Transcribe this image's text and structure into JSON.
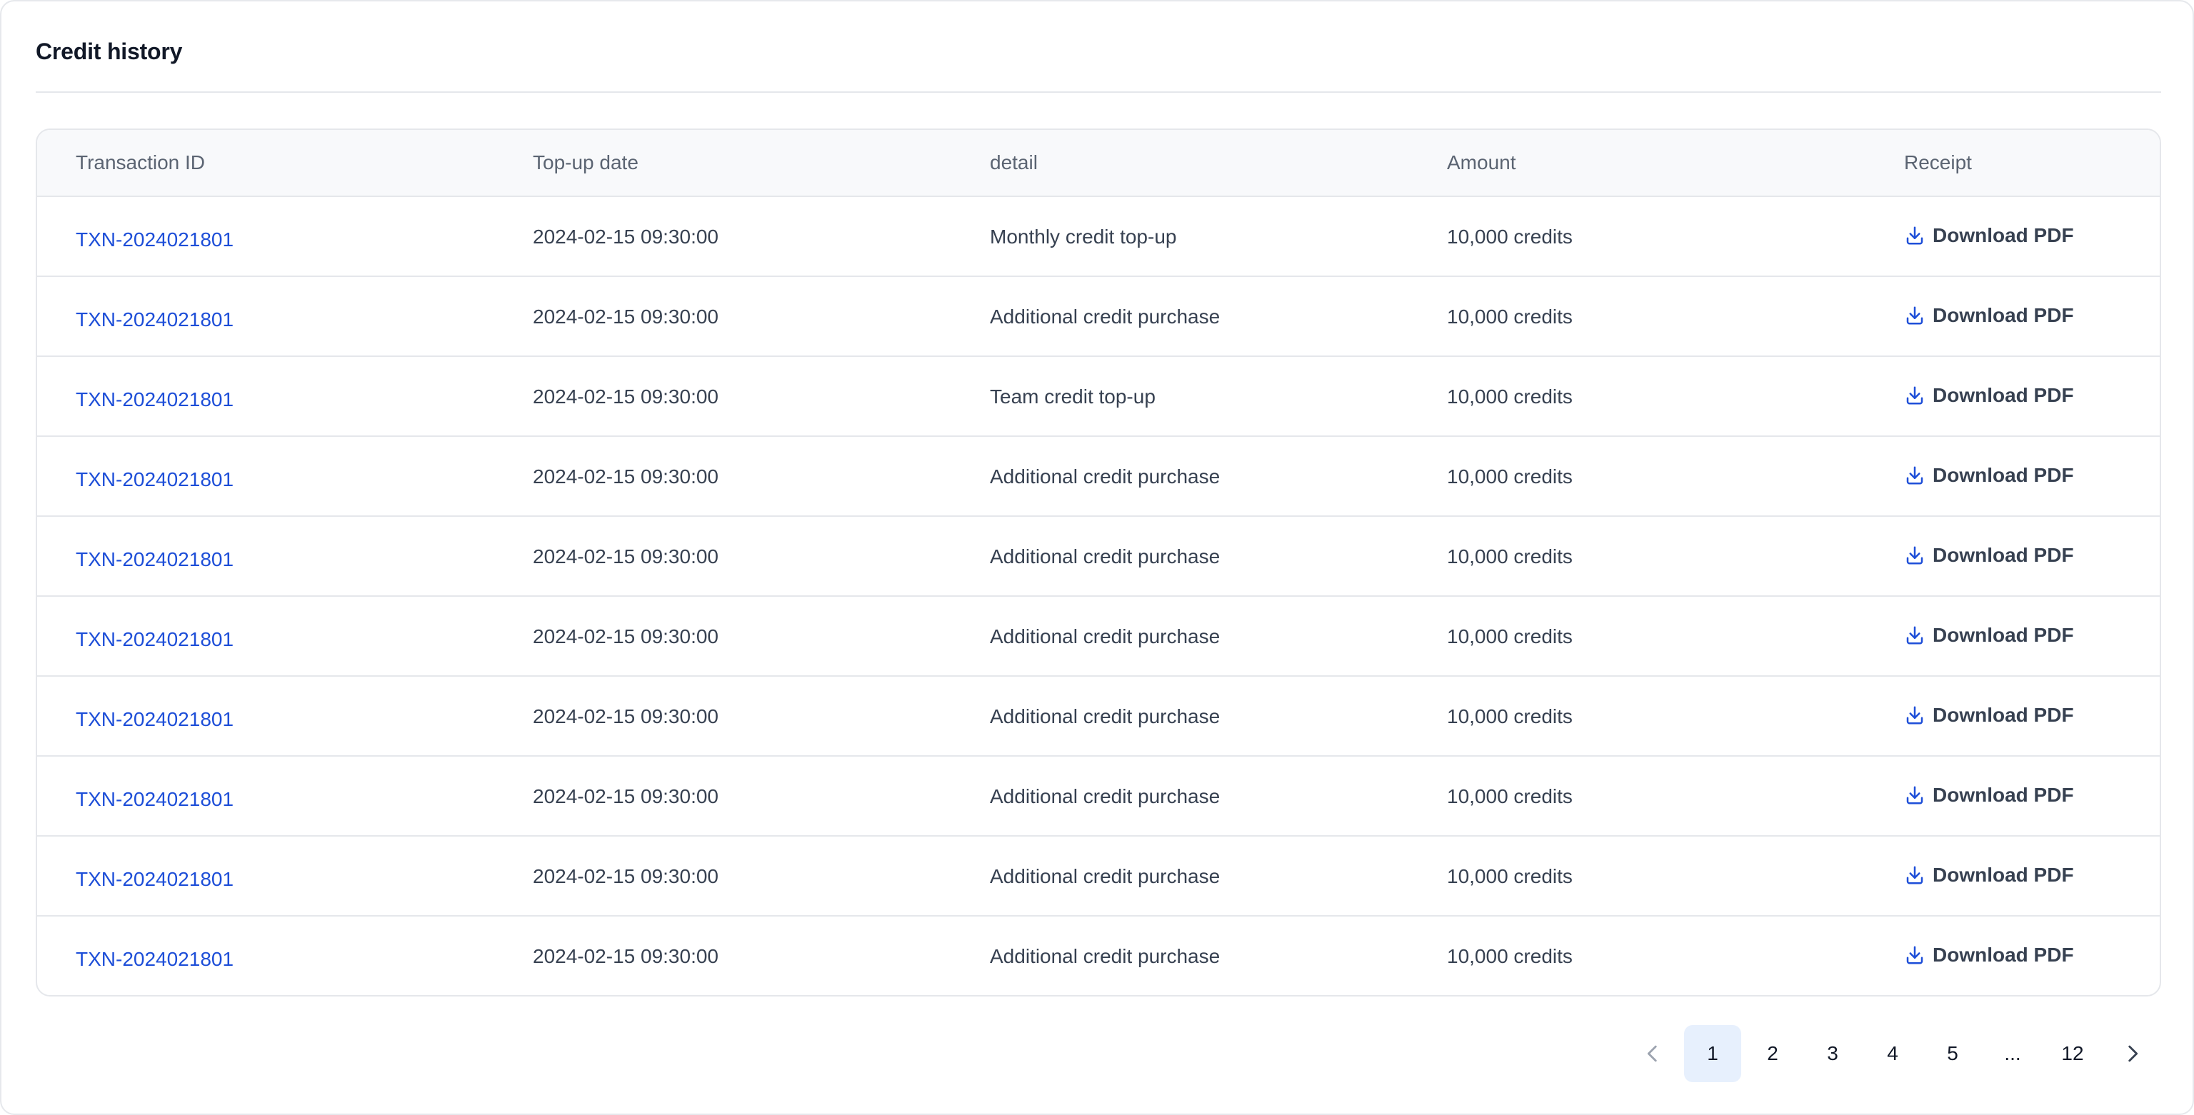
{
  "card": {
    "title": "Credit history"
  },
  "table": {
    "columns": [
      "Transaction ID",
      "Top-up date",
      "detail",
      "Amount",
      "Receipt"
    ],
    "rows": [
      {
        "id": "TXN-2024021801",
        "date": "2024-02-15 09:30:00",
        "detail": "Monthly credit top-up",
        "amount": "10,000 credits",
        "receipt": "Download PDF"
      },
      {
        "id": "TXN-2024021801",
        "date": "2024-02-15 09:30:00",
        "detail": "Additional credit purchase",
        "amount": "10,000 credits",
        "receipt": "Download PDF"
      },
      {
        "id": "TXN-2024021801",
        "date": "2024-02-15 09:30:00",
        "detail": "Team credit top-up",
        "amount": "10,000 credits",
        "receipt": "Download PDF"
      },
      {
        "id": "TXN-2024021801",
        "date": "2024-02-15 09:30:00",
        "detail": "Additional credit purchase",
        "amount": "10,000 credits",
        "receipt": "Download PDF"
      },
      {
        "id": "TXN-2024021801",
        "date": "2024-02-15 09:30:00",
        "detail": "Additional credit purchase",
        "amount": "10,000 credits",
        "receipt": "Download PDF"
      },
      {
        "id": "TXN-2024021801",
        "date": "2024-02-15 09:30:00",
        "detail": "Additional credit purchase",
        "amount": "10,000 credits",
        "receipt": "Download PDF"
      },
      {
        "id": "TXN-2024021801",
        "date": "2024-02-15 09:30:00",
        "detail": "Additional credit purchase",
        "amount": "10,000 credits",
        "receipt": "Download PDF"
      },
      {
        "id": "TXN-2024021801",
        "date": "2024-02-15 09:30:00",
        "detail": "Additional credit purchase",
        "amount": "10,000 credits",
        "receipt": "Download PDF"
      },
      {
        "id": "TXN-2024021801",
        "date": "2024-02-15 09:30:00",
        "detail": "Additional credit purchase",
        "amount": "10,000 credits",
        "receipt": "Download PDF"
      },
      {
        "id": "TXN-2024021801",
        "date": "2024-02-15 09:30:00",
        "detail": "Additional credit purchase",
        "amount": "10,000 credits",
        "receipt": "Download PDF"
      }
    ]
  },
  "pagination": {
    "pages": [
      "1",
      "2",
      "3",
      "4",
      "5",
      "...",
      "12"
    ],
    "current": "1",
    "prev_icon": "chevron-left-icon",
    "next_icon": "chevron-right-icon"
  },
  "colors": {
    "link": "#1d4ed8",
    "header_bg": "#f8f9fb",
    "active_page_bg": "#e7f0fd",
    "border": "#e5e7eb"
  },
  "icons": {
    "receipt": "download-icon"
  }
}
